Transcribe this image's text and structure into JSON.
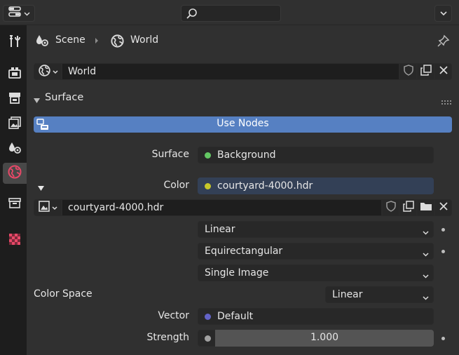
{
  "breadcrumb": {
    "scene": "Scene",
    "world": "World"
  },
  "world_block": {
    "name": "World"
  },
  "surface_panel": {
    "title": "Surface",
    "use_nodes_label": "Use Nodes"
  },
  "properties": {
    "surface": {
      "label": "Surface",
      "value": "Background",
      "socket_color": "#63c763"
    },
    "color": {
      "label": "Color",
      "value": "courtyard-4000.hdr",
      "socket_color": "#c7c729"
    },
    "image": {
      "name": "courtyard-4000.hdr"
    },
    "interpolation": "Linear",
    "projection": "Equirectangular",
    "source": "Single Image",
    "color_space": {
      "label": "Color Space",
      "value": "Linear"
    },
    "vector": {
      "label": "Vector",
      "value": "Default",
      "socket_color": "#6363c7"
    },
    "strength": {
      "label": "Strength",
      "value": "1.000"
    }
  },
  "colors": {
    "accent": "#5680c2",
    "tab_active": "#484848",
    "world_tab_icon": "#e84868"
  },
  "tabs": [
    "tool-tab",
    "render-tab",
    "output-tab",
    "view-layer-tab",
    "scene-tab",
    "world-tab",
    "object-tab",
    "texture-tab"
  ]
}
